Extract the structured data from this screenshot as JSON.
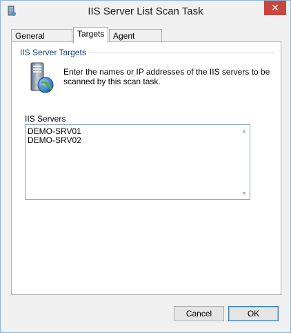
{
  "window": {
    "title": "IIS Server List Scan Task",
    "close_glyph": "✕"
  },
  "tabs": [
    {
      "label": "General Settings",
      "active": false
    },
    {
      "label": "Targets",
      "active": true
    },
    {
      "label": "Agent Settings",
      "active": false
    }
  ],
  "targets": {
    "group_title": "IIS Server Targets",
    "description": "Enter the names or IP addresses of the IIS servers to be scanned by this scan task.",
    "list_label": "IIS Servers",
    "servers": [
      "DEMO-SRV01",
      "DEMO-SRV02"
    ]
  },
  "buttons": {
    "cancel": "Cancel",
    "ok": "OK"
  },
  "colors": {
    "close_button": "#c7463e",
    "group_title": "#1a3c78",
    "input_border": "#7a9cc6"
  },
  "icons": {
    "app": "app-icon",
    "server": "server-globe-icon"
  }
}
